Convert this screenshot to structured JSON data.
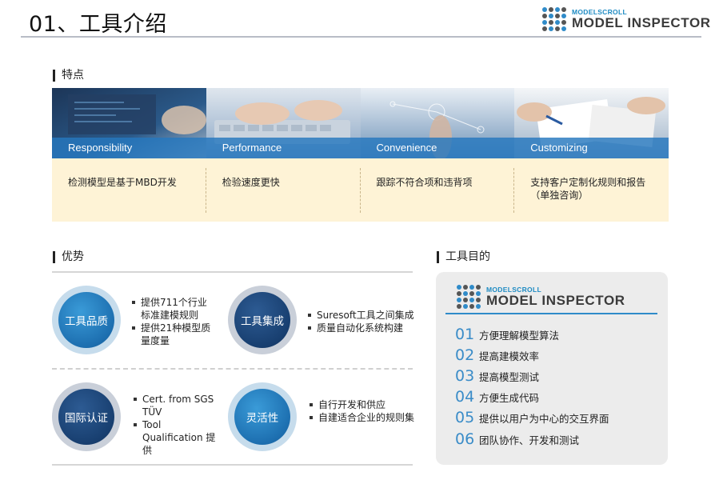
{
  "page": {
    "title": "01、工具介绍"
  },
  "logo": {
    "small": "MODELSCROLL",
    "big": "MODEL INSPECTOR"
  },
  "features": {
    "heading": "特点",
    "cards": [
      {
        "title": "Responsibility",
        "desc": "检测模型是基于MBD开发"
      },
      {
        "title": "Performance",
        "desc": "检验速度更快"
      },
      {
        "title": "Convenience",
        "desc": "跟踪不符合项和违背项"
      },
      {
        "title": "Customizing",
        "desc": "支持客户定制化规则和报告（单独咨询）"
      }
    ]
  },
  "advantages": {
    "heading": "优势",
    "items": [
      {
        "badge": "工具品质",
        "bullets": [
          "提供711个行业标准建模规则",
          "提供21种模型质量度量"
        ]
      },
      {
        "badge": "工具集成",
        "bullets": [
          "Suresoft工具之间集成",
          "质量自动化系统构建"
        ]
      },
      {
        "badge": "国际认证",
        "bullets": [
          "Cert. from SGS TÜV",
          "Tool Qualification 提供"
        ]
      },
      {
        "badge": "灵活性",
        "bullets": [
          "自行开发和供应",
          "自建适合企业的规则集"
        ]
      }
    ]
  },
  "purpose": {
    "heading": "工具目的",
    "goals": [
      {
        "num": "01",
        "text": "方便理解模型算法"
      },
      {
        "num": "02",
        "text": "提高建模效率"
      },
      {
        "num": "03",
        "text": "提高模型测试"
      },
      {
        "num": "04",
        "text": "方便生成代码"
      },
      {
        "num": "05",
        "text": "提供以用户为中心的交互界面"
      },
      {
        "num": "06",
        "text": "团队协作、开发和测试"
      }
    ]
  },
  "colors": {
    "accent": "#2f8bc9",
    "feature_bg": "#fef3d6",
    "band": "#2678be",
    "panel_bg": "#ececec"
  }
}
